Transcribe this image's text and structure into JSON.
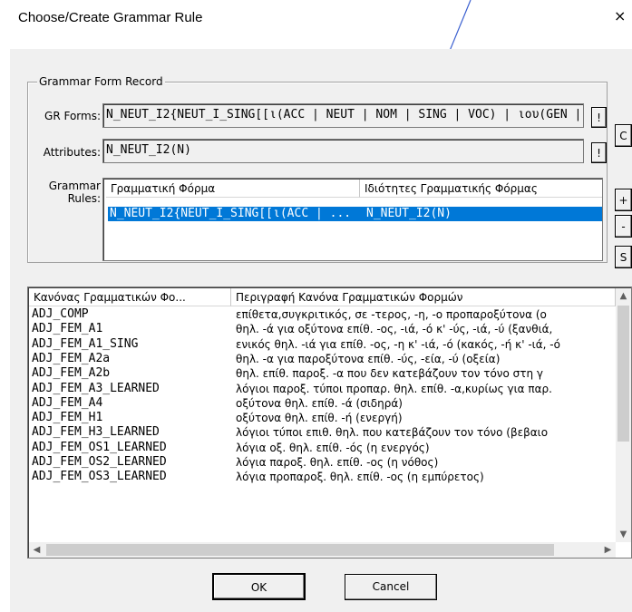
{
  "window": {
    "title": "Choose/Create Grammar Rule",
    "close_label": "×"
  },
  "group": {
    "legend": "Grammar Form Record"
  },
  "fields": {
    "gr_forms_label": "GR Forms:",
    "gr_forms_value": "N_NEUT_I2{NEUT_I_SING[[ι(ACC | NEUT | NOM | SING | VOC) | ιου(GEN |",
    "gr_forms_button": "!",
    "attributes_label": "Attributes:",
    "attributes_value": "N_NEUT_I2(N)",
    "attributes_button": "!",
    "grammar_rules_label_1": "Grammar",
    "grammar_rules_label_2": "Rules:"
  },
  "side_buttons": {
    "c": "C",
    "plus": "+",
    "minus": "-",
    "s": "S"
  },
  "rules_table": {
    "columns": [
      "Γραμματική Φόρμα",
      "Ιδιότητες Γραμματικής Φόρμας"
    ],
    "rows": [
      [
        "N_NEUT_I2{NEUT_I_SING[[ι(ACC | ...",
        "N_NEUT_I2(N)"
      ]
    ]
  },
  "rule_list": {
    "columns": [
      "Κανόνας Γραμματικών Φο...",
      "Περιγραφή Κανόνα Γραμματικών Φορμών"
    ],
    "rows": [
      [
        "ADJ_COMP",
        "επίθετα,συγκριτικός, σε -τερος, -η, -ο προπαροξύτονα (ο"
      ],
      [
        "ADJ_FEM_A1",
        "θηλ. -ά για οξύτονα επίθ. -ος, -ιά, -ό κ' -ύς, -ιά, -ύ (ξανθιά,"
      ],
      [
        "ADJ_FEM_A1_SING",
        "ενικός θηλ. -ιά για επίθ. -ος, -η κ' -ιά, -ό (κακός, -ή κ' -ιά, -ό"
      ],
      [
        "ADJ_FEM_A2a",
        "θηλ. -α για παροξύτονα επίθ. -ύς, -εία, -ύ (οξεία)"
      ],
      [
        "ADJ_FEM_A2b",
        "θηλ. επίθ. παροξ. -α που δεν κατεβάζουν τον τόνο στη γ"
      ],
      [
        "ADJ_FEM_A3_LEARNED",
        "λόγιοι παροξ. τύποι προπαρ. θηλ. επίθ. -α,κυρίως για παρ."
      ],
      [
        "ADJ_FEM_A4",
        "οξύτονα θηλ. επίθ. -ά (σιδηρά)"
      ],
      [
        "ADJ_FEM_H1",
        "οξύτονα θηλ. επίθ. -ή (ενεργή)"
      ],
      [
        "ADJ_FEM_H3_LEARNED",
        "λόγιοι τύποι επιθ. θηλ. που κατεβάζουν τον τόνο (βεβαιο"
      ],
      [
        "ADJ_FEM_OS1_LEARNED",
        "λόγια οξ. θηλ. επίθ. -ός (η ενεργός)"
      ],
      [
        "ADJ_FEM_OS2_LEARNED",
        "λόγια παροξ. θηλ. επίθ. -ος (η νόθος)"
      ],
      [
        "ADJ_FEM_OS3_LEARNED",
        "λόγια προπαροξ. θηλ. επίθ. -ος (η εμπύρετος)"
      ]
    ]
  },
  "scroll": {
    "up": "▲",
    "down": "▼",
    "left": "◀",
    "right": "▶"
  },
  "buttons": {
    "ok": "OK",
    "cancel": "Cancel"
  }
}
